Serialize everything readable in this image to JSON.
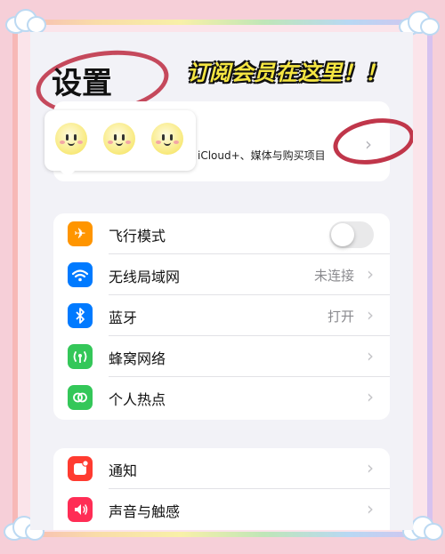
{
  "header": {
    "title": "设置",
    "banner": "订阅会员在这里！！"
  },
  "account": {
    "subtitle": "iCloud+、媒体与购买项目",
    "chevron": "›"
  },
  "group1": [
    {
      "label": "飞行模式",
      "icon": "airplane-icon",
      "color": "#ff9500",
      "control": "toggle",
      "on": false
    },
    {
      "label": "无线局域网",
      "icon": "wifi-icon",
      "color": "#007aff",
      "value": "未连接"
    },
    {
      "label": "蓝牙",
      "icon": "bluetooth-icon",
      "color": "#007aff",
      "value": "打开"
    },
    {
      "label": "蜂窝网络",
      "icon": "cellular-icon",
      "color": "#34c759",
      "value": ""
    },
    {
      "label": "个人热点",
      "icon": "hotspot-icon",
      "color": "#34c759",
      "value": ""
    }
  ],
  "group2": [
    {
      "label": "通知",
      "icon": "notification-icon",
      "color": "#ff3b30",
      "value": ""
    },
    {
      "label": "声音与触感",
      "icon": "sound-icon",
      "color": "#ff2d55",
      "value": ""
    }
  ],
  "chevron": "›",
  "colors": {
    "accent_circle": "#c0364a",
    "banner_text": "#f5e642"
  }
}
